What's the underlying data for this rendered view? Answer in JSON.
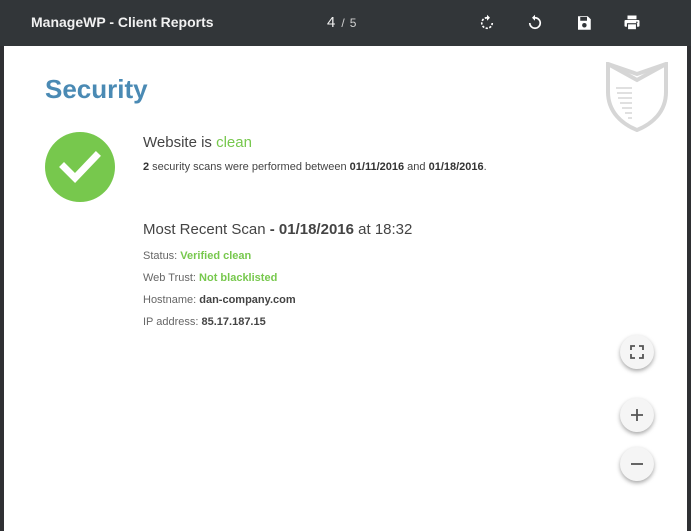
{
  "toolbar": {
    "title": "ManageWP - Client Reports",
    "page_current": "4",
    "page_separator": "/",
    "page_total": "5",
    "icons": [
      "rotate-clockwise-icon",
      "rotate-counterclockwise-icon",
      "save-icon",
      "print-icon"
    ]
  },
  "report": {
    "section_title": "Security",
    "status": {
      "prefix": "Website is ",
      "word": "clean"
    },
    "summary": {
      "count": "2",
      "text1": " security scans were performed between ",
      "start_date": "01/11/2016",
      "text2": " and ",
      "end_date": "01/18/2016",
      "text3": "."
    },
    "recent_scan": {
      "label": "Most Recent Scan",
      "date": " - 01/18/2016",
      "at": " at 18:32"
    },
    "details": [
      {
        "label": "Status: ",
        "value": "Verified clean"
      },
      {
        "label": "Web Trust: ",
        "value": "Not blacklisted"
      },
      {
        "label": "Hostname: ",
        "value": "dan-company.com"
      },
      {
        "label": "IP address: ",
        "value": "85.17.187.15"
      }
    ]
  },
  "controls": {
    "icons": [
      "fullscreen-icon",
      "plus-icon",
      "minus-icon"
    ]
  },
  "colors": {
    "accent_blue": "#4a8ab4",
    "clean_green": "#77c84d",
    "toolbar": "#323639"
  }
}
